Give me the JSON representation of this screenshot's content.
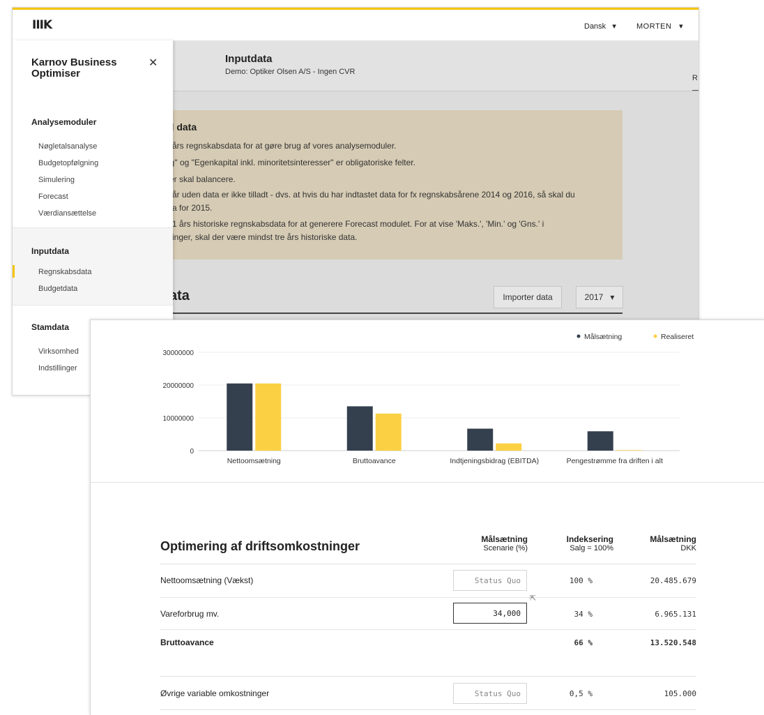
{
  "app": {
    "logo": "IIIK",
    "language": "Dansk",
    "user": "MORTEN",
    "name": "Karnov Business Optimiser"
  },
  "sidebar": {
    "sections": [
      {
        "title": "Analysemoduler",
        "items": [
          "Nøgletalsanalyse",
          "Budgetopfølgning",
          "Simulering",
          "Forecast",
          "Værdiansættelse"
        ]
      },
      {
        "title": "Inputdata",
        "items": [
          "Regnskabsdata",
          "Budgetdata"
        ]
      },
      {
        "title": "Stamdata",
        "items": [
          "Virksomhed",
          "Indstillinger"
        ]
      }
    ]
  },
  "page": {
    "title": "Inputdata",
    "subtitle": "Demo: Optiker Olsen A/S - Ingen CVR",
    "tab_fragment": "R",
    "info_title": "til data",
    "info_lines": [
      "2 års regnskabsdata for at gøre brug af vores analysemoduler.",
      "ng\" og \"Egenkapital inkl. minoritetsinteresser\" er obligatoriske felter.",
      "ver skal balancere.",
      "e år uden data er ikke tilladt - dvs. at hvis du har indtastet data for fx regnskabsårene 2014 og 2016, så skal du",
      "ata for 2015.",
      "n 1 års historiske regnskabsdata for at generere Forecast modulet. For at vise 'Maks.', 'Min.' og 'Gns.' i",
      "tninger, skal der være mindst tre års historiske data."
    ],
    "section_title": "ata",
    "import_button": "Importer data",
    "year": "2017"
  },
  "chart_data": {
    "type": "bar",
    "categories": [
      "Nettoomsætning",
      "Bruttoavance",
      "Indtjeningsbidrag (EBITDA)",
      "Pengestrømme fra driften i alt"
    ],
    "series": [
      {
        "name": "Målsætning",
        "color": "#35404e",
        "values": [
          20485679,
          13520548,
          6700000,
          5900000
        ]
      },
      {
        "name": "Realiseret",
        "color": "#fbd043",
        "values": [
          20485679,
          11300000,
          2200000,
          150000
        ]
      }
    ],
    "ylim": [
      0,
      30000000
    ],
    "yticks": [
      "0",
      "10000000",
      "20000000",
      "30000000"
    ],
    "grid": true,
    "legend": "top-right"
  },
  "table": {
    "title": "Optimering af driftsomkostninger",
    "headers": [
      {
        "title": "Målsætning",
        "sub": "Scenarie (%)"
      },
      {
        "title": "Indeksering",
        "sub": "Salg = 100%"
      },
      {
        "title": "Målsætning",
        "sub": "DKK"
      }
    ],
    "rows": [
      {
        "label": "Nettoomsætning (Vækst)",
        "input": "Status Quo",
        "index": "100 %",
        "dkk": "20.485.679"
      },
      {
        "label": "Vareforbrug mv.",
        "input": "34,000",
        "index": "34 %",
        "dkk": "6.965.131"
      },
      {
        "label": "Bruttoavance",
        "input": "",
        "index": "66 %",
        "dkk": "13.520.548"
      },
      {
        "label": "Øvrige variable omkostninger",
        "input": "Status Quo",
        "index": "0,5 %",
        "dkk": "105.000"
      }
    ]
  }
}
